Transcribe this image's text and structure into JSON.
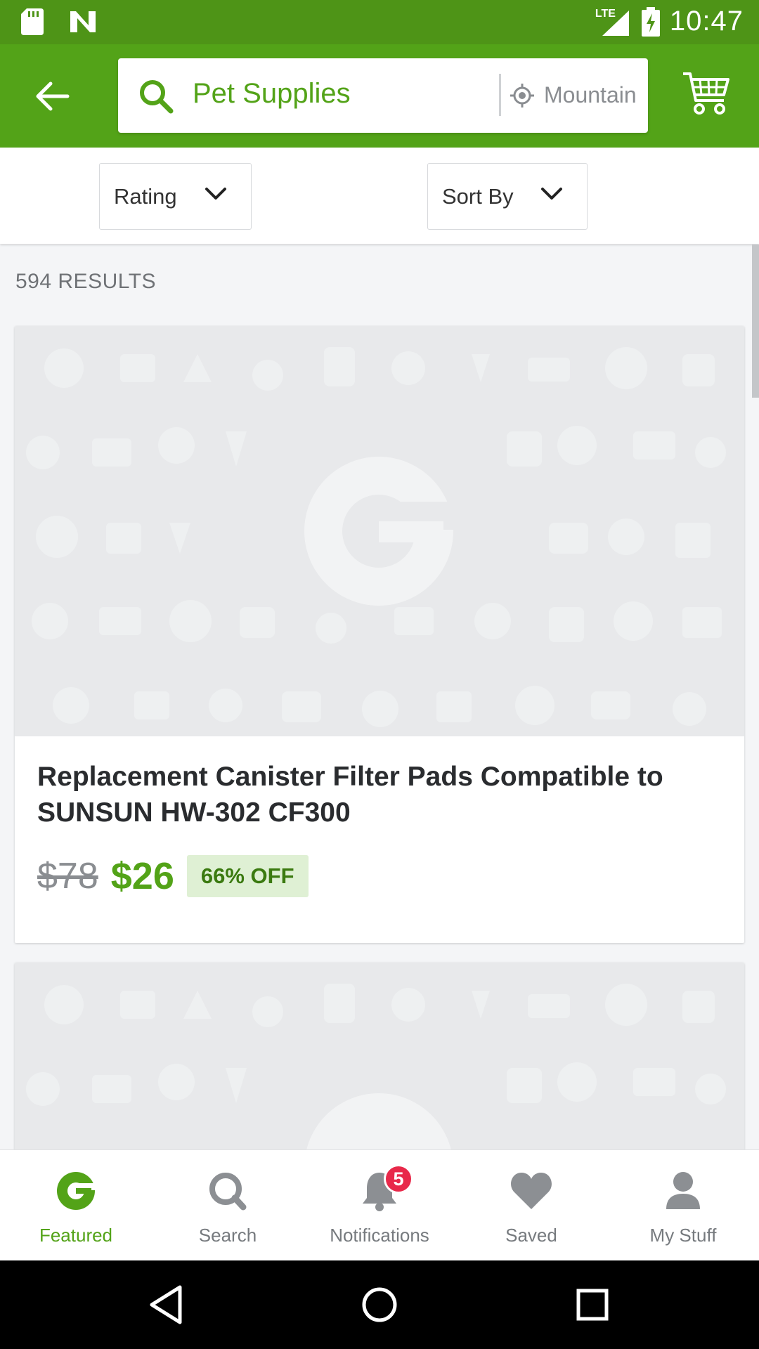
{
  "status_bar": {
    "time": "10:47",
    "network": "LTE"
  },
  "header": {
    "search_text": "Pet Supplies",
    "location_text": "Mountain View"
  },
  "filters": {
    "rating_label": "Rating",
    "sort_label": "Sort By"
  },
  "results": {
    "count_label": "594 RESULTS"
  },
  "cards": [
    {
      "title": "Replacement Canister Filter Pads Compatible to SUNSUN HW-302 CF300",
      "old_price": "$78",
      "new_price": "$26",
      "discount": "66% OFF"
    }
  ],
  "bottom_nav": {
    "items": [
      {
        "label": "Featured",
        "icon": "groupon-g-icon"
      },
      {
        "label": "Search",
        "icon": "search-icon"
      },
      {
        "label": "Notifications",
        "icon": "bell-icon"
      },
      {
        "label": "Saved",
        "icon": "heart-icon"
      },
      {
        "label": "My Stuff",
        "icon": "person-icon"
      }
    ],
    "notification_count": "5"
  },
  "colors": {
    "brand_green": "#53a318",
    "status_green": "#4e9417",
    "badge_red": "#e8294a"
  }
}
